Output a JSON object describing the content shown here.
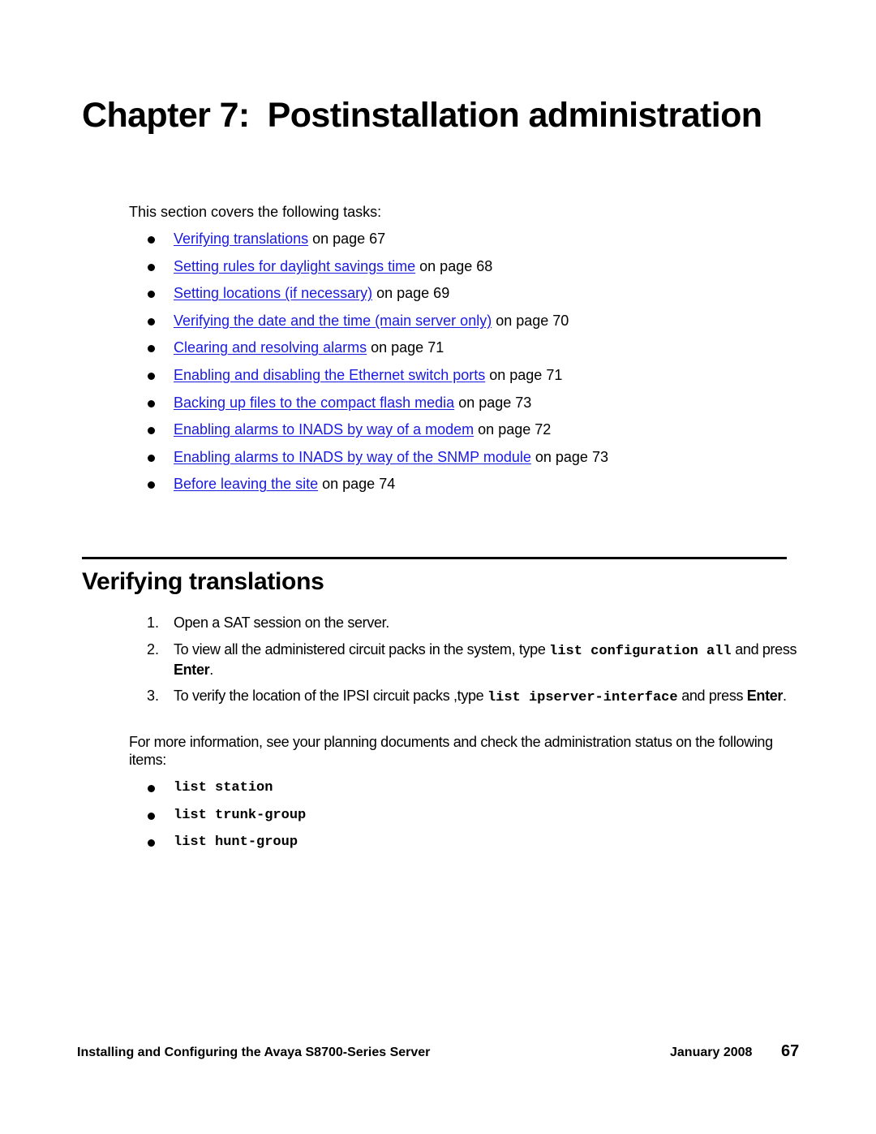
{
  "chapter": {
    "label": "Chapter 7:",
    "title": "Postinstallation administration"
  },
  "intro": "This section covers the following tasks:",
  "tasks": [
    {
      "link": "Verifying translations",
      "suffix": " on page 67"
    },
    {
      "link": "Setting rules for daylight savings time",
      "suffix": " on page 68"
    },
    {
      "link": "Setting locations (if necessary)",
      "suffix": " on page 69"
    },
    {
      "link": "Verifying the date and the time (main server only)",
      "suffix": " on page 70"
    },
    {
      "link": "Clearing and resolving alarms",
      "suffix": " on page 71"
    },
    {
      "link": "Enabling and disabling the Ethernet switch ports",
      "suffix": " on page 71"
    },
    {
      "link": "Backing up files to the compact flash media",
      "suffix": " on page 73"
    },
    {
      "link": "Enabling alarms to INADS by way of a modem",
      "suffix": " on page 72"
    },
    {
      "link": "Enabling alarms to INADS by way of the SNMP module",
      "suffix": " on page 73"
    },
    {
      "link": "Before leaving the site",
      "suffix": " on page 74"
    }
  ],
  "section": {
    "title": "Verifying translations",
    "steps": [
      {
        "num": "1.",
        "text": "Open a SAT session on the server."
      },
      {
        "num": "2.",
        "pre": "To view all the administered circuit packs in the system, type ",
        "cmd": "list configuration all",
        "post_pre": " and press ",
        "key": "Enter",
        "post": "."
      },
      {
        "num": "3.",
        "pre": "To verify the location of the IPSI circuit packs ,type ",
        "cmd": "list ipserver-interface",
        "post_pre": " and press ",
        "key": "Enter",
        "post": "."
      }
    ],
    "paragraph": "For more information, see your planning documents and check the administration status on the following items:",
    "commands": [
      "list station",
      "list trunk-group",
      "list hunt-group"
    ]
  },
  "footer": {
    "book_title": "Installing and Configuring the Avaya S8700-Series Server",
    "date": "January 2008",
    "page_number": "67"
  }
}
